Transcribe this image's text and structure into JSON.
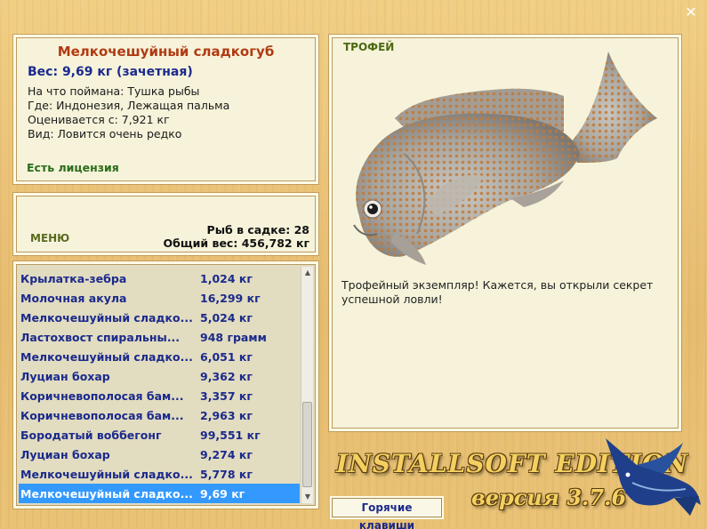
{
  "window": {
    "close_glyph": "✕"
  },
  "fish_info": {
    "title": "Мелкочешуйный сладкогуб",
    "weight": "Вес: 9,69 кг (зачетная)",
    "lines": [
      "На что поймана: Тушка рыбы",
      "Где: Индонезия, Лежащая пальма",
      "Оценивается с: 7,921 кг",
      "Вид: Ловится очень редко"
    ],
    "license": "Есть лицензия"
  },
  "menu": {
    "menu_label": "МЕНЮ",
    "fish_in_cage": "Рыб в садке: 28",
    "total_weight": "Общий вес: 456,782 кг"
  },
  "catch_list": [
    {
      "name": "Крылатка-зебра",
      "weight": "1,024 кг"
    },
    {
      "name": "Молочная акула",
      "weight": "16,299 кг"
    },
    {
      "name": "Мелкочешуйный сладко...",
      "weight": "5,024 кг"
    },
    {
      "name": "Ластохвост спиральны...",
      "weight": "948 грамм"
    },
    {
      "name": "Мелкочешуйный сладко...",
      "weight": "6,051 кг"
    },
    {
      "name": "Луциан бохар",
      "weight": "9,362 кг"
    },
    {
      "name": "Коричневополосая бам...",
      "weight": "3,357 кг"
    },
    {
      "name": "Коричневополосая бам...",
      "weight": "2,963 кг"
    },
    {
      "name": "Бородатый воббегонг",
      "weight": "99,551 кг"
    },
    {
      "name": "Луциан бохар",
      "weight": "9,274 кг"
    },
    {
      "name": "Мелкочешуйный сладко...",
      "weight": "5,778 кг"
    },
    {
      "name": "Мелкочешуйный сладко...",
      "weight": "9,69 кг",
      "selected": true
    }
  ],
  "trophy": {
    "title": "ТРОФЕЙ",
    "text": "Трофейный экземпляр! Кажется, вы открыли секрет успешной ловли!"
  },
  "footer": {
    "hotkeys": "Горячие клавиши",
    "brand": "INSTALLSOFT EDITION",
    "version": "версия 3.7.6"
  },
  "colors": {
    "title_red": "#b13a12",
    "list_blue": "#1b2a8c",
    "selection": "#3399ff",
    "license_green": "#2a6d1a"
  }
}
